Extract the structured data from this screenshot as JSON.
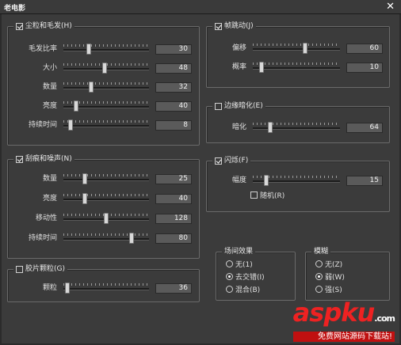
{
  "window": {
    "title": "老电影"
  },
  "groups": {
    "dust": {
      "title": "尘粒和毛发(H)",
      "checked": true,
      "rows": [
        {
          "label": "毛发比率",
          "value": "30",
          "pos": 0.3
        },
        {
          "label": "大小",
          "value": "48",
          "pos": 0.48
        },
        {
          "label": "数量",
          "value": "32",
          "pos": 0.32
        },
        {
          "label": "亮度",
          "value": "40",
          "pos": 0.15
        },
        {
          "label": "持续时间",
          "value": "8",
          "pos": 0.08
        }
      ]
    },
    "jitter": {
      "title": "帧跳动(J)",
      "checked": true,
      "rows": [
        {
          "label": "偏移",
          "value": "60",
          "pos": 0.6
        },
        {
          "label": "概率",
          "value": "10",
          "pos": 0.1
        }
      ]
    },
    "vignette": {
      "title": "边缘暗化(E)",
      "checked": false,
      "rows": [
        {
          "label": "暗化",
          "value": "64",
          "pos": 0.2
        }
      ]
    },
    "scratch": {
      "title": "刮痕和噪声(N)",
      "checked": true,
      "rows": [
        {
          "label": "数量",
          "value": "25",
          "pos": 0.25
        },
        {
          "label": "亮度",
          "value": "40",
          "pos": 0.25
        },
        {
          "label": "移动性",
          "value": "128",
          "pos": 0.5
        },
        {
          "label": "持续时间",
          "value": "80",
          "pos": 0.8
        }
      ]
    },
    "flicker": {
      "title": "闪烁(F)",
      "checked": true,
      "rows": [
        {
          "label": "幅度",
          "value": "15",
          "pos": 0.15
        }
      ],
      "random_label": "随机(R)",
      "random_checked": false
    },
    "grain": {
      "title": "胶片颗粒(G)",
      "checked": false,
      "rows": [
        {
          "label": "颗粒",
          "value": "36",
          "pos": 0.05
        }
      ]
    },
    "field": {
      "title": "场间效果",
      "options": [
        {
          "label": "无(1)",
          "selected": false
        },
        {
          "label": "去交错(I)",
          "selected": true
        },
        {
          "label": "混合(B)",
          "selected": false
        }
      ]
    },
    "blur": {
      "title": "模糊",
      "options": [
        {
          "label": "无(Z)",
          "selected": false
        },
        {
          "label": "弱(W)",
          "selected": true
        },
        {
          "label": "强(S)",
          "selected": false
        }
      ]
    }
  },
  "watermark": {
    "logo_a": "asp",
    "logo_b": "ku",
    "domain": ".com",
    "sub": "免费网站源码下载站!"
  }
}
